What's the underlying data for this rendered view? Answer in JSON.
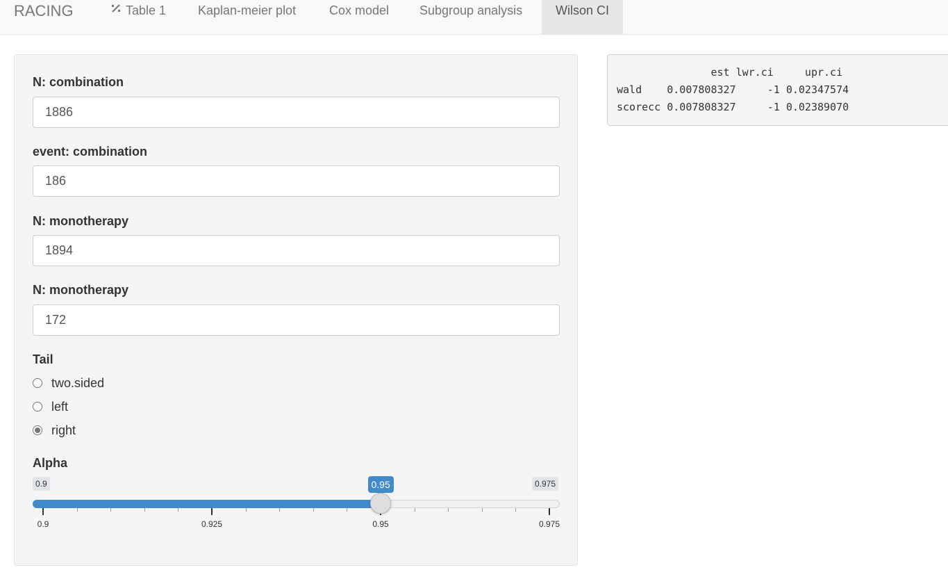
{
  "navbar": {
    "brand": "RACING",
    "tabs": [
      {
        "label": "Table 1",
        "icon": "magic-wand-icon"
      },
      {
        "label": "Kaplan-meier plot"
      },
      {
        "label": "Cox model"
      },
      {
        "label": "Subgroup analysis"
      },
      {
        "label": "Wilson CI",
        "active": true
      }
    ]
  },
  "inputs": [
    {
      "label": "N: combination",
      "value": "1886"
    },
    {
      "label": "event: combination",
      "value": "186"
    },
    {
      "label": "N: monotherapy",
      "value": "1894"
    },
    {
      "label": "N: monotherapy",
      "value": "172"
    }
  ],
  "tail": {
    "label": "Tail",
    "options": [
      "two.sided",
      "left",
      "right"
    ],
    "selected": "right"
  },
  "alpha": {
    "label": "Alpha",
    "min": 0.9,
    "max": 0.975,
    "value": 0.95,
    "min_label": "0.9",
    "max_label": "0.975",
    "value_label": "0.95",
    "ticks": [
      "0.9",
      "0.925",
      "0.95",
      "0.975"
    ]
  },
  "output": {
    "header": "               est lwr.ci     upr.ci",
    "rows": [
      "wald    0.007808327     -1 0.02347574",
      "scorecc 0.007808327     -1 0.02389070"
    ]
  },
  "colors": {
    "accent": "#428bca",
    "navbar_bg": "#f8f8f8",
    "active_tab_bg": "#e7e7e7",
    "panel_bg": "#f5f5f5"
  }
}
